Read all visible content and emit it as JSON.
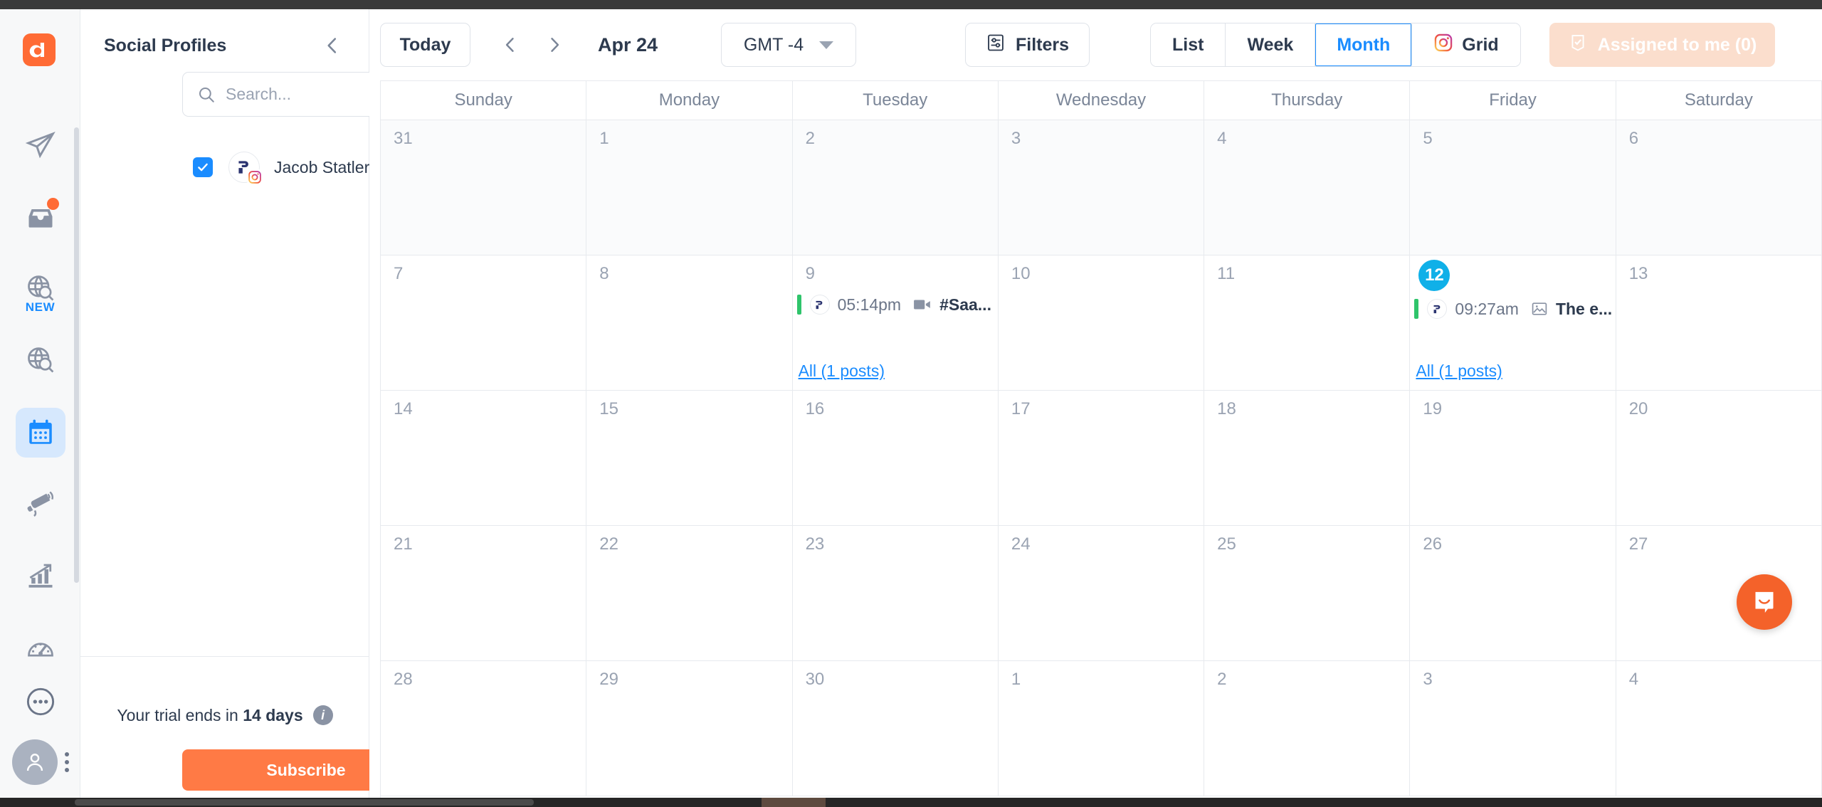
{
  "rail": {
    "logo_alt": "app-logo",
    "items": [
      {
        "name": "publish",
        "icon": "paper-plane-icon",
        "badge": false,
        "tag": ""
      },
      {
        "name": "inbox",
        "icon": "inbox-icon",
        "badge": true,
        "tag": ""
      },
      {
        "name": "discovery-new",
        "icon": "globe-search-icon",
        "badge": false,
        "tag": "NEW"
      },
      {
        "name": "monitoring",
        "icon": "globe-search-icon",
        "badge": false,
        "tag": ""
      },
      {
        "name": "calendar",
        "icon": "calendar-icon",
        "badge": false,
        "tag": "",
        "active": true
      },
      {
        "name": "campaigns",
        "icon": "megaphone-icon",
        "badge": false,
        "tag": ""
      },
      {
        "name": "analytics",
        "icon": "chart-growth-icon",
        "badge": false,
        "tag": ""
      },
      {
        "name": "reports",
        "icon": "speedometer-icon",
        "badge": false,
        "tag": ""
      }
    ],
    "more_icon": "more-circle-icon",
    "avatar_icon": "user-avatar-icon",
    "kebab_icon": "kebab-menu-icon"
  },
  "sidebar": {
    "title": "Social Profiles",
    "collapse_icon": "chevron-left-icon",
    "search": {
      "placeholder": "Search...",
      "value": "",
      "icon": "search-icon"
    },
    "profiles": [
      {
        "name": "Jacob Statler",
        "checked": true,
        "network": "instagram",
        "avatar_icon": "statler-logo-icon"
      }
    ],
    "trial_prefix": "Your trial ends in ",
    "trial_days": "14 days",
    "info_icon": "info-icon",
    "subscribe_label": "Subscribe"
  },
  "toolbar": {
    "today_label": "Today",
    "prev_icon": "chevron-left-icon",
    "next_icon": "chevron-right-icon",
    "month_label": "Apr 24",
    "timezone": "GMT -4",
    "timezone_caret": "chevron-down-icon",
    "filters_label": "Filters",
    "filters_icon": "sliders-icon",
    "views": [
      {
        "label": "List",
        "active": false,
        "icon": ""
      },
      {
        "label": "Week",
        "active": false,
        "icon": ""
      },
      {
        "label": "Month",
        "active": true,
        "icon": ""
      },
      {
        "label": "Grid",
        "active": false,
        "icon": "instagram-icon"
      }
    ],
    "assigned_label": "Assigned to me (0)",
    "assigned_icon": "checklist-icon"
  },
  "calendar": {
    "weekdays": [
      "Sunday",
      "Monday",
      "Tuesday",
      "Wednesday",
      "Thursday",
      "Friday",
      "Saturday"
    ],
    "rows": [
      {
        "other_month": true,
        "cells": [
          {
            "day": "31"
          },
          {
            "day": "1"
          },
          {
            "day": "2"
          },
          {
            "day": "3"
          },
          {
            "day": "4"
          },
          {
            "day": "5"
          },
          {
            "day": "6"
          }
        ]
      },
      {
        "other_month": false,
        "cells": [
          {
            "day": "7"
          },
          {
            "day": "8"
          },
          {
            "day": "9",
            "events": [
              {
                "time": "05:14pm",
                "title": "#Saa...",
                "media_type": "video",
                "network": "instagram",
                "status_color": "#2fc46b",
                "avatar_icon": "statler-logo-icon"
              }
            ],
            "all_link": "All (1 posts)"
          },
          {
            "day": "10"
          },
          {
            "day": "11"
          },
          {
            "day": "12",
            "is_today": true,
            "events": [
              {
                "time": "09:27am",
                "title": "The e...",
                "media_type": "image",
                "network": "instagram",
                "status_color": "#2fc46b",
                "avatar_icon": "statler-logo-icon"
              }
            ],
            "all_link": "All (1 posts)"
          },
          {
            "day": "13"
          }
        ]
      },
      {
        "other_month": false,
        "cells": [
          {
            "day": "14"
          },
          {
            "day": "15"
          },
          {
            "day": "16"
          },
          {
            "day": "17"
          },
          {
            "day": "18"
          },
          {
            "day": "19"
          },
          {
            "day": "20"
          }
        ]
      },
      {
        "other_month": false,
        "cells": [
          {
            "day": "21"
          },
          {
            "day": "22"
          },
          {
            "day": "23"
          },
          {
            "day": "24"
          },
          {
            "day": "25"
          },
          {
            "day": "26"
          },
          {
            "day": "27"
          }
        ]
      },
      {
        "other_month": false,
        "cells": [
          {
            "day": "28"
          },
          {
            "day": "29"
          },
          {
            "day": "30"
          },
          {
            "day": "1"
          },
          {
            "day": "2"
          },
          {
            "day": "3"
          },
          {
            "day": "4"
          }
        ]
      }
    ]
  },
  "chat": {
    "icon": "intercom-chat-icon",
    "color": "#f4622a"
  },
  "colors": {
    "brand_orange": "#ff6b35",
    "accent_blue": "#1a8cff",
    "today_blue": "#10b0e8",
    "status_green": "#2fc46b",
    "text_dark": "#2d3a4e",
    "text_muted": "#9aa3b2"
  }
}
